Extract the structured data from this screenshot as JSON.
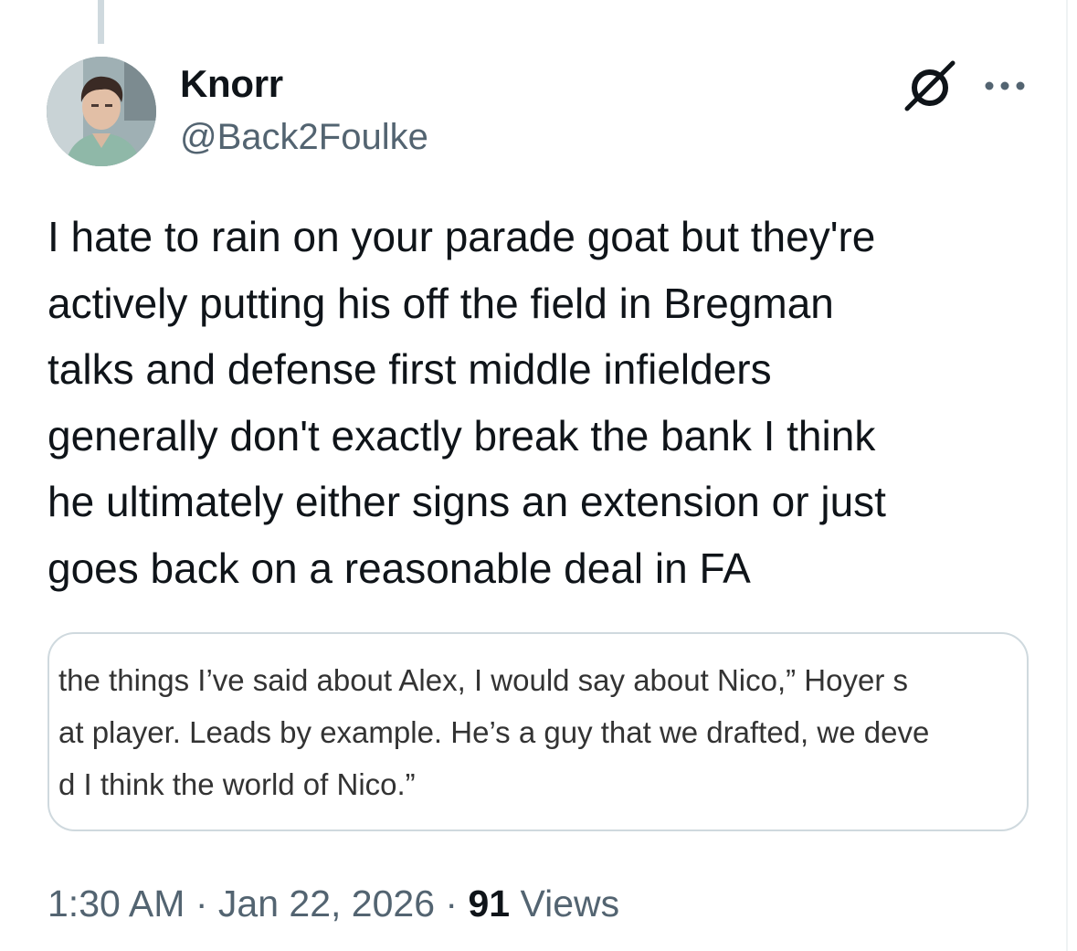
{
  "tweet": {
    "author": {
      "display_name": "Knorr",
      "handle": "@Back2Foulke"
    },
    "text": "I hate to rain on your parade goat but they're\nactively putting his off the field in Bregman\ntalks and defense first middle infielders\ngenerally don't exactly break the bank I think\nhe ultimately either signs an extension or just\ngoes back on a reasonable deal in FA",
    "media_quote_lines": [
      "the things I’ve said about Alex, I would say about Nico,” Hoyer s",
      "at player. Leads by example. He’s a guy that we drafted, we deve",
      "d I think the world of Nico.”"
    ],
    "meta": {
      "time": "1:30 AM",
      "separator": "·",
      "date": "Jan 22, 2026",
      "views_count": "91",
      "views_label": "Views"
    }
  },
  "icons": {
    "grok": "grok-icon",
    "more": "more-icon"
  },
  "colors": {
    "text_primary": "#0f1419",
    "text_secondary": "#536471",
    "border": "#cfd9de"
  }
}
